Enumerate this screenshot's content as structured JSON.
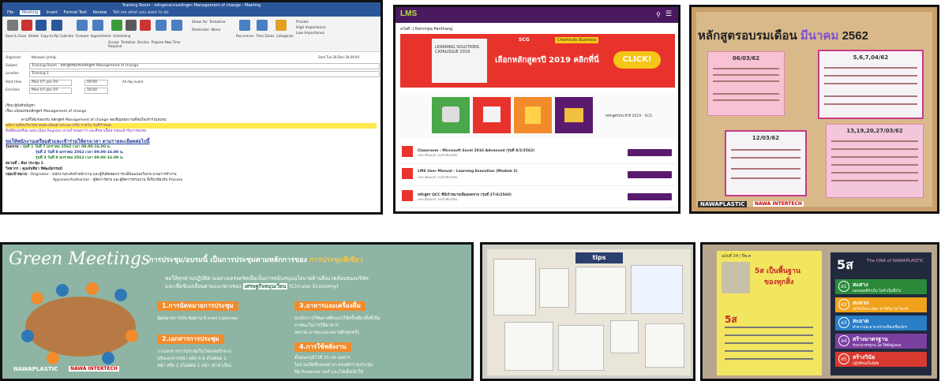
{
  "outlook": {
    "window_title": "Training Room : หลักสูตรอบรมหลักสูตร Management of change - Meeting",
    "tabs": [
      "File",
      "Meeting",
      "Insert",
      "Format Text",
      "Review"
    ],
    "tell_me": "Tell me what you want to do",
    "ribbon_buttons": [
      "Save & Close",
      "Delete",
      "Copy to My Calendar",
      "Forward",
      "Appointment",
      "Scheduling",
      "Accept",
      "Tentative",
      "Decline",
      "Propose New Time",
      "Respond",
      "Show As",
      "Reminder",
      "Recurrence",
      "Time Zones",
      "Categorize",
      "Private",
      "High Importance",
      "Low Importance"
    ],
    "show_as_value": "Tentative",
    "reminder_value": "None",
    "organizer_label": "Organizer",
    "organizer_value": "Narawan Jantipi",
    "sent_value": "Sent   Tue 26-Dec-18 09:04",
    "subject_label": "Subject",
    "subject_value": "Training Room : หลักสูตรอบรมหลักสูตร Management of change",
    "location_label": "Location",
    "location_value": "Training 1",
    "start_label": "Start time",
    "start_date": "Mon 07-Jan-19",
    "start_time": "09:00",
    "end_label": "End time",
    "end_date": "Mon 07-Jan-19",
    "end_time": "16:00",
    "all_day": "All day event",
    "body_to": "เรียน ผู้บังคับบัญชา",
    "body_subject": "เรื่อง แจ้งอบรมหลักสูตร Management of change",
    "body_p1": "ตามที่ได้แจ้งอบรม หลักสูตร Management of change ขอเชิญพนักงานที่สนใจเข้าร่วมอบรม",
    "body_p2": "พนักงานที่สนใจกรุณาลงทะเบียนผ่านระบบ LMS ภายใน วันที่กำหนด",
    "body_p3": "สิ่งที่ต้องเตรียม ลงทะเบียน Register ตามกำหนดการ และศึกษาเนื้อหาก่อนเข้ารับการอบรม",
    "section_heading": "ขอให้พนักงานเตรียมตัวและเข้าร่วมให้ตรงเวลา ตามรายละเอียดต่อไปนี้",
    "round_label": "รุ่นอบรม",
    "round_1": "รุ่นที่ 1 วันที่ 7 มกราคม 2562  เวลา 09.00-16.00 น.",
    "round_2": "รุ่นที่ 2 วันที่ 8 มกราคม 2562  เวลา 09.00-16.00 น.",
    "round_3": "รุ่นที่ 3 วันที่ 9 มกราคม 2562  เวลา 09.00-16.00 น.",
    "place_label": "สถานที่",
    "place_value": "ห้อง ประชุม 1",
    "lecturer_label": "วิทยากร",
    "lecturer_value": "คุณจันทิมา พิพัฒน์ธรรมม์",
    "target_label": "กลุ่มเป้าหมาย",
    "target_value": "Originator : พนักงานระดับหัวหน้างาน และผู้รับผิดชอบการเปลี่ยนแปลงในกระบวนการทำงาน",
    "approver": "Approver/Authorizer : ผู้จัดการฝ่าย และผู้จัดการส่วนงาน ที่เกี่ยวข้องกับ Process"
  },
  "lms": {
    "logo": "LMS",
    "user": "สวัสดี :) Kornnipa Panthang",
    "banner_text": "เลือกหลักสูตรปี 2019 คลิกที่นี่",
    "banner_catalogue": "LEARNING SOLUTIONS CATALOGUE 2019",
    "banner_brand": "SCG",
    "banner_business": "Chemicals Business",
    "banner_click": "CLICK!",
    "cat_label": "หลักสูตรประจำปี 2019 - SCG",
    "rows": [
      {
        "title": "Classroom : Microsoft Excel 2016 Advanced (รุ่นที่ 8/2/2562)",
        "sub": "ลงทะเบียนแล้ว  รอเข้าห้องเรียน"
      },
      {
        "title": "LMS User Manual - Learning Execution (Module 2)",
        "sub": "ลงทะเบียนแล้ว  รอเข้าห้องเรียน"
      },
      {
        "title": "หลักสูตร QCC ที่มีเป้าหมายเพิ่มยอดขาย (รุ่นที่ 27/6/2560)",
        "sub": "ลงทะเบียนแล้ว  รอเข้าห้องเรียน"
      }
    ]
  },
  "training_board": {
    "title_main": "หลักสูตรอบรมเดือน",
    "title_month": "มีนาคม",
    "title_year": "2562",
    "notes": [
      "06/03/62",
      "5,6,7,04/62",
      "12/03/62",
      "13,19,20,27/03/62"
    ],
    "footer": "NAWAPLASTIC",
    "footer_2": "NAWA INTERTECH"
  },
  "green_meetings": {
    "title": "Green Meetings",
    "subtitle": "การประชุม/อบรมนี้ เป็นการประชุมตามหลักการของ",
    "subtitle_highlight": "การประชุมสีเขียว",
    "intro_1": "ขอให้ทุกท่านปฏิบัติตามอย่างเคร่งครัดเพื่อเป็นการสนับสนุนนโยบายด้านสิ่งแวดล้อมของบริษัท",
    "intro_2": "และเพื่อขับเคลื่อนตามแนวทางของ",
    "intro_highlight": "เศรษฐกิจหมุนเวียน",
    "intro_3": "(Circular Economy)",
    "items": [
      {
        "label": "1.การนัดหมายการประชุม",
        "lines": [
          "นัดหมายการประชุมผ่าน E-mail Calendar"
        ]
      },
      {
        "label": "2.เอกสารการประชุม",
        "lines": [
          "วางเอกสารการประชุมในโฟลเดอร์กลาง",
          "ปรับเอกสารหน้า-หลัง 4-6 สไลด์ต่อ 1",
          "หน้า หรือ 2 สไลด์ต่อ 1 หน้า (ถ้าจำเป็น)"
        ]
      },
      {
        "label": "3.อาหารและเครื่องดื่ม",
        "lines": [
          "ยกเลิกการใช้พลาสติกแบบใช้ครั้งเดียวทิ้งที่เป็น",
          "ภาชนะในการใช้อาหาร",
          "งดขวด ภาชนะและพลาสติกทุกครั้ง"
        ]
      },
      {
        "label": "4.การใช้พลังงาน",
        "lines": [
          "ตั้งอุณหภูมิไว้ที่ 25-26 องศาฯ",
          "ไม่ลวนเปิดสิ่งของต่างๆ ตอนพักรวมประชุม",
          "ปิด Projector แอร์ และไฟเมื่อเลิกใช้"
        ]
      }
    ],
    "footer": "NAWAPLASTIC",
    "footer_2": "NAWA INTERTECH"
  },
  "bulletin": {
    "poster_label": "tips"
  },
  "poster_5s": {
    "left_header": "ฉบับที่ 34 / ปีพ.ศ",
    "left_title": "5ส เป็นพื้นฐาน",
    "left_title_2": "ของทุกสิ่ง",
    "left_big": "5ส",
    "right_title": "5ส",
    "right_sub": "The DNA of NAWAPLASTIC",
    "bands": [
      {
        "num": "ส1",
        "label": "สะสาง",
        "sub": "แยกของที่จำเป็น ไม่จำเป็นทิ้งไป",
        "color": "#2a8a3a"
      },
      {
        "num": "ส2",
        "label": "สะดวก",
        "sub": "จัดให้เป็นระเบียบ หาได้ใน 30 วินาที",
        "color": "#f0a21c"
      },
      {
        "num": "ส3",
        "label": "สะอาด",
        "sub": "ทำความสะอาด ตรวจเช็คเครื่องจักร",
        "color": "#2a7ec8"
      },
      {
        "num": "ส4",
        "label": "สร้างมาตรฐาน",
        "sub": "รักษามาตรฐาน 3ส ให้ดีอยู่เสมอ",
        "color": "#7b3fa0"
      },
      {
        "num": "ส5",
        "label": "สร้างวินัย",
        "sub": "ปฏิบัติจนเป็นนิสัย",
        "color": "#d93a30"
      }
    ]
  }
}
